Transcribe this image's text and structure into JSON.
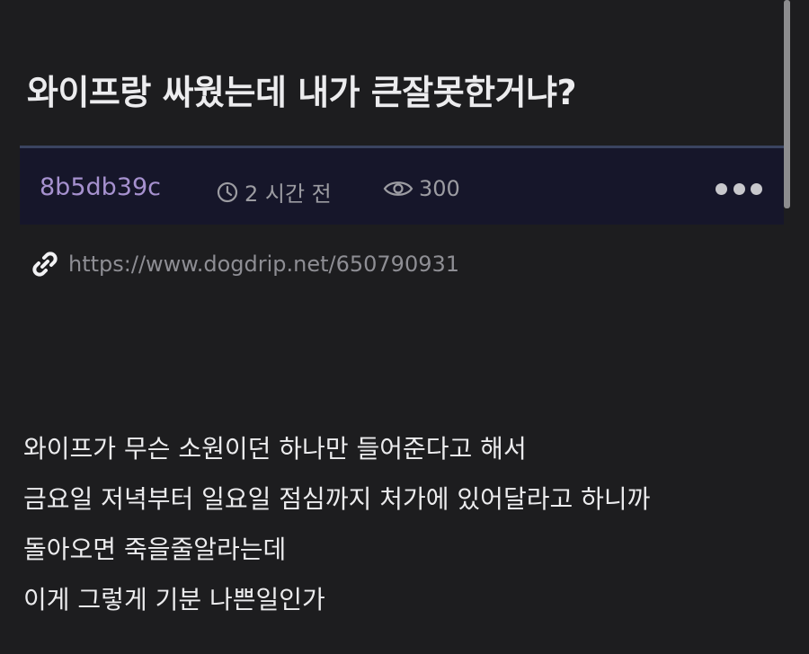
{
  "post": {
    "title": "와이프랑 싸웠는데 내가 큰잘못한거냐?",
    "author": "8b5db39c",
    "time": "2 시간 전",
    "views": "300",
    "source_url": "https://www.dogdrip.net/650790931",
    "body_lines": [
      "와이프가 무슨 소원이던 하나만 들어준다고 해서",
      "금요일 저녁부터 일요일 점심까지 처가에 있어달라고 하니까",
      "돌아오면 죽을줄알라는데",
      "이게 그렇게 기분 나쁜일인가"
    ]
  },
  "icons": {
    "time": "clock-icon",
    "views": "eye-icon",
    "link": "link-icon",
    "more": "more-dots-icon"
  },
  "colors": {
    "background": "#1d1d1f",
    "meta_bar": "#16162a",
    "author": "#a691cf",
    "muted_text": "#9c9ca2",
    "body_text": "#ececee"
  }
}
